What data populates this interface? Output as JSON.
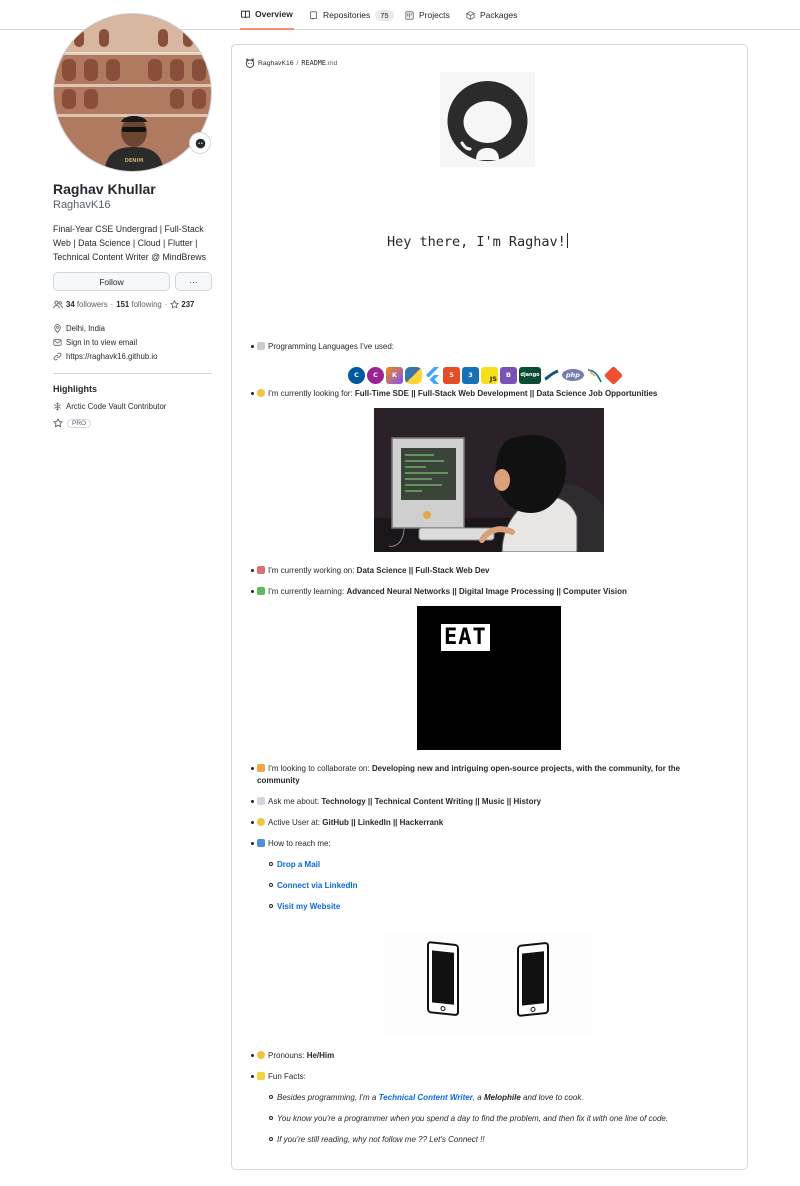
{
  "tabs": [
    {
      "label": "Overview",
      "icon": "book-icon",
      "active": true
    },
    {
      "label": "Repositories",
      "icon": "repo-icon",
      "count": "75"
    },
    {
      "label": "Projects",
      "icon": "project-icon"
    },
    {
      "label": "Packages",
      "icon": "package-icon"
    }
  ],
  "profile": {
    "full_name": "Raghav Khullar",
    "username": "RaghavK16",
    "bio": "Final-Year CSE Undergrad | Full-Stack Web | Data Science | Cloud | Flutter | Technical Content Writer @ MindBrews",
    "follow_label": "Follow",
    "more_label": "···",
    "followers_count": "34",
    "followers_label": "followers",
    "following_count": "151",
    "following_label": "following",
    "stars_count": "237",
    "location": "Delhi, India",
    "email": "Sign in to view email",
    "website": "https://raghavk16.github.io"
  },
  "highlights": {
    "title": "Highlights",
    "items": [
      {
        "label": "Arctic Code Vault Contributor",
        "icon": "snowflake-icon"
      },
      {
        "label": "PRO",
        "icon": "star-icon"
      }
    ]
  },
  "readme": {
    "owner": "RaghavK16",
    "separator": "/",
    "file": "README",
    "ext": ".md",
    "greeting": "Hey there, I'm Raghav!",
    "languages_label": "Programming Languages I've used:",
    "languages": [
      "C++",
      "C#",
      "Kotlin",
      "Python",
      "Flutter",
      "HTML5",
      "CSS3",
      "JavaScript",
      "Bootstrap",
      "Django",
      "Matplotlib",
      "PHP",
      "MySQL",
      "Git"
    ],
    "looking_for_label": "I'm currently looking for: ",
    "looking_for": "Full-Time SDE || Full-Stack Web Development || Data Science Job Opportunities",
    "working_on_label": "I'm currently working on: ",
    "working_on": "Data Science || Full-Stack Web Dev",
    "learning_label": "I'm currently learning: ",
    "learning": "Advanced Neural Networks || Digital Image Processing || Computer Vision",
    "eat_text": "EAT",
    "collab_label": "I'm looking to collaborate on: ",
    "collab_line1": "Developing new and intriguing open-source projects, with the community, for the",
    "collab_line2": "community",
    "ask_label": "Ask me about: ",
    "ask": "Technology || Technical Content Writing || Music || History",
    "active_label": "Active User at: ",
    "active": "GitHub || LinkedIn || Hackerrank",
    "reach_label": "How to reach me:",
    "reach_links": [
      "Drop a Mail",
      "Connect via LinkedIn",
      "Visit my Website"
    ],
    "pronouns_label": "Pronouns: ",
    "pronouns": "He/Him",
    "fun_label": "Fun Facts:",
    "fun1_pre": "Besides programming, I'm a ",
    "fun1_link": "Technical Content Writer",
    "fun1_mid": ", a ",
    "fun1_bold": "Melophile",
    "fun1_post": " and love to cook.",
    "fun2": "You know you're a programmer when you spend a day to find the problem, and then fix it with one line of code.",
    "fun3": "If you're still reading, why not follow me ?? Let's Connect !!"
  },
  "colors": {
    "accent": "#fd8c73",
    "link": "#0969da",
    "border": "#d0d7de"
  }
}
